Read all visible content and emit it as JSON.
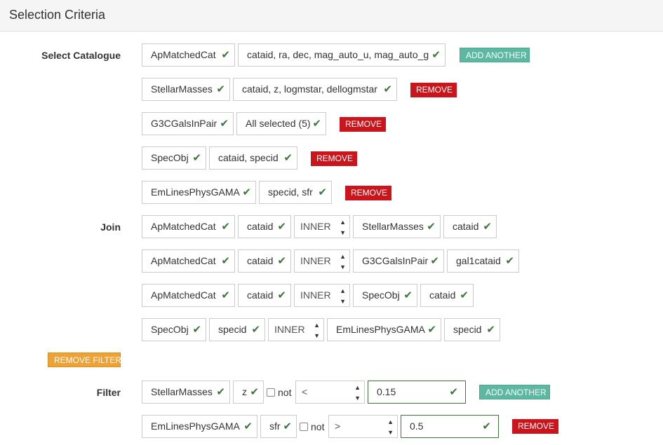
{
  "header": {
    "title": "Selection Criteria"
  },
  "labels": {
    "select_catalogue": "Select Catalogue",
    "join": "Join",
    "filter": "Filter"
  },
  "catalogues": [
    {
      "catalogue": "ApMatchedCat",
      "columns": "cataid, ra, dec, mag_auto_u, mag_auto_g",
      "button": "ADD ANOTHER"
    },
    {
      "catalogue": "StellarMasses",
      "columns": "cataid, z, logmstar, dellogmstar",
      "button": "REMOVE"
    },
    {
      "catalogue": "G3CGalsInPair",
      "columns": "All selected (5)",
      "button": "REMOVE"
    },
    {
      "catalogue": "SpecObj",
      "columns": "cataid, specid",
      "button": "REMOVE"
    },
    {
      "catalogue": "EmLinesPhysGAMA",
      "columns": "specid, sfr",
      "button": "REMOVE"
    }
  ],
  "joins": [
    {
      "left_cat": "ApMatchedCat",
      "left_col": "cataid",
      "type": "INNER",
      "right_cat": "StellarMasses",
      "right_col": "cataid"
    },
    {
      "left_cat": "ApMatchedCat",
      "left_col": "cataid",
      "type": "INNER",
      "right_cat": "G3CGalsInPair",
      "right_col": "gal1cataid"
    },
    {
      "left_cat": "ApMatchedCat",
      "left_col": "cataid",
      "type": "INNER",
      "right_cat": "SpecObj",
      "right_col": "cataid"
    },
    {
      "left_cat": "SpecObj",
      "left_col": "specid",
      "type": "INNER",
      "right_cat": "EmLinesPhysGAMA",
      "right_col": "specid"
    }
  ],
  "remove_filter_label": "REMOVE FILTER",
  "filters": [
    {
      "catalogue": "StellarMasses",
      "column": "z",
      "not_label": "not",
      "not_checked": false,
      "operator": "<",
      "value": "0.15",
      "button": "ADD ANOTHER"
    },
    {
      "catalogue": "EmLinesPhysGAMA",
      "column": "sfr",
      "not_label": "not",
      "not_checked": false,
      "operator": ">",
      "value": "0.5",
      "button": "REMOVE"
    }
  ],
  "icons": {
    "check": "checkmark-icon",
    "select_arrows": "updown-arrows-icon"
  },
  "colors": {
    "accent_green": "#5cb8a0",
    "danger_red": "#c9151b",
    "warning_orange": "#eea236",
    "valid_green": "#3c763d"
  }
}
